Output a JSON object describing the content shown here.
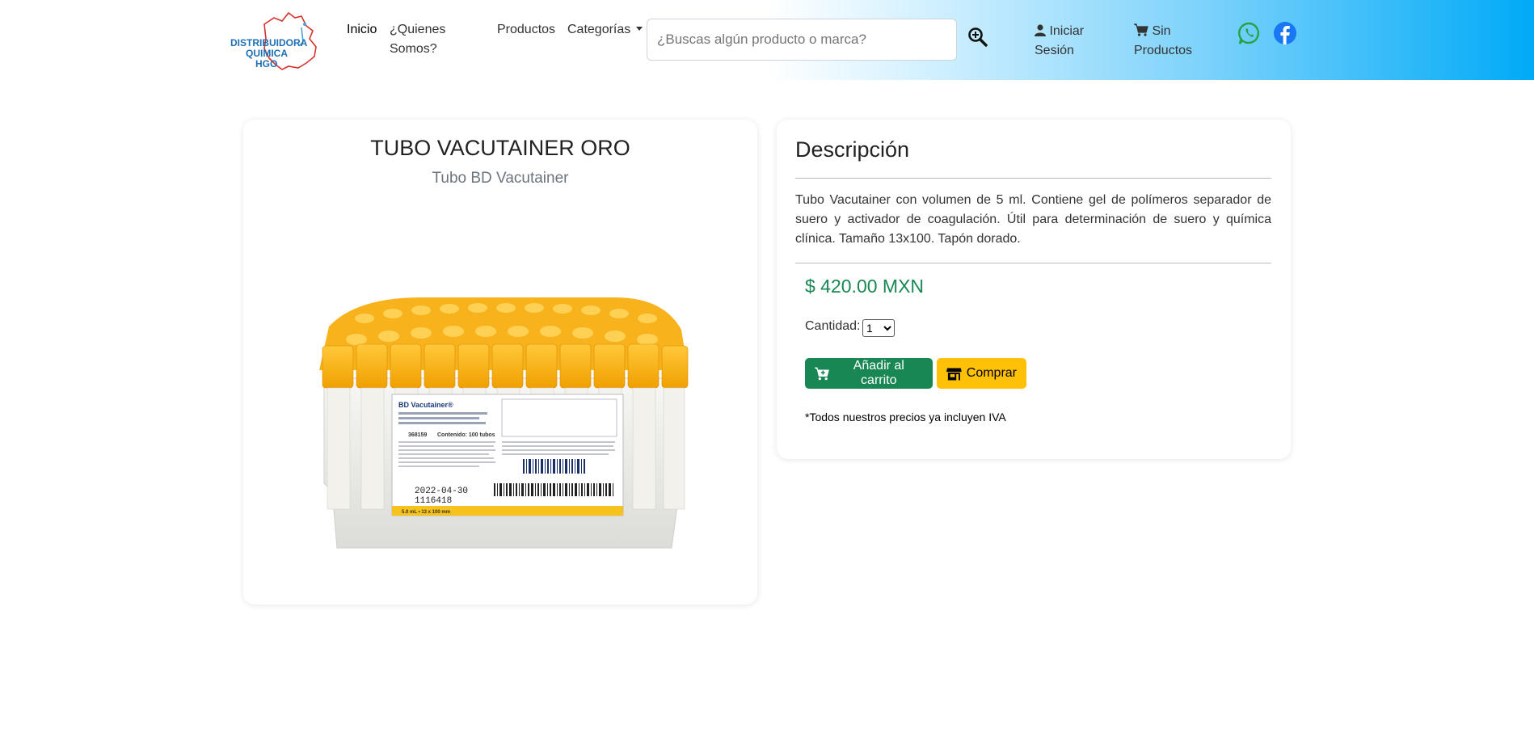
{
  "brand": {
    "logo_lines": [
      "DISTRIBUIDORA",
      "QUIMICA",
      "HGO"
    ]
  },
  "nav": {
    "inicio": "Inicio",
    "quienes_1": "¿Quienes",
    "quienes_2": "Somos?",
    "productos": "Productos",
    "categorias": "Categorías"
  },
  "search": {
    "placeholder": "¿Buscas algún producto o marca?"
  },
  "account": {
    "login_1": "Iniciar",
    "login_2": "Sesión",
    "cart_1": "Sin",
    "cart_2": "Productos"
  },
  "product": {
    "title": "TUBO VACUTAINER ORO",
    "subtitle": "Tubo BD Vacutainer",
    "image_labels": {
      "brand": "BD Vacutainer®",
      "date": "2022-04-30",
      "lot": "1116418",
      "size": "5.0 mL • 13 x 100 mm",
      "ref": "368159",
      "content": "Contenido: 100 tubos"
    }
  },
  "description": {
    "heading": "Descripción",
    "text": "Tubo Vacutainer con volumen de 5 ml. Contiene gel de polímeros separador de suero y activador de coagulación. Útil para determinación de suero y química clínica. Tamaño 13x100. Tapón dorado.",
    "price": "$ 420.00 MXN",
    "qty_label": "Cantidad:",
    "qty_value": "1",
    "add_cart": "Añadir al carrito",
    "buy": "Comprar",
    "tax_note": "*Todos nuestros precios ya incluyen IVA"
  },
  "colors": {
    "price_green": "#198754",
    "cart_button": "#198754",
    "buy_button": "#ffc107",
    "header_gradient_end": "#00aaf7",
    "whatsapp": "#25a244",
    "facebook": "#1877f2"
  }
}
